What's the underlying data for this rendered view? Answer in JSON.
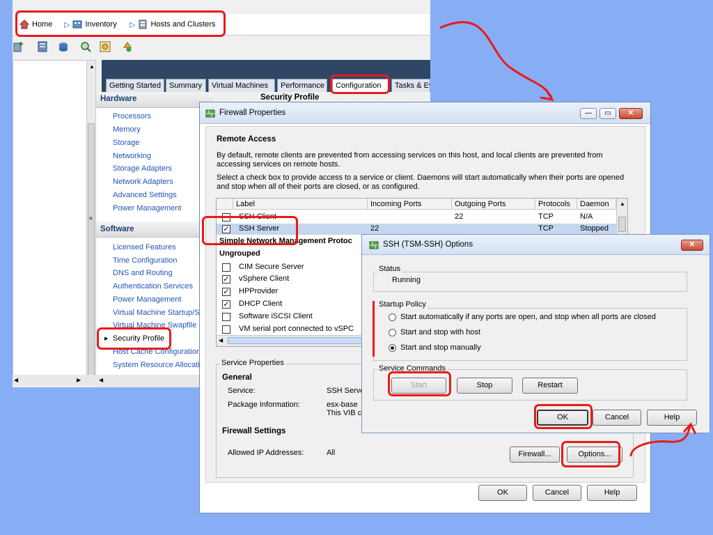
{
  "breadcrumb": {
    "home": "Home",
    "inventory": "Inventory",
    "hosts": "Hosts and Clusters"
  },
  "tabs": [
    "Getting Started",
    "Summary",
    "Virtual Machines",
    "Performance",
    "Configuration",
    "Tasks & Ev"
  ],
  "active_tab": "Configuration",
  "nav": {
    "hardware_title": "Hardware",
    "hardware": [
      "Processors",
      "Memory",
      "Storage",
      "Networking",
      "Storage Adapters",
      "Network Adapters",
      "Advanced Settings",
      "Power Management"
    ],
    "software_title": "Software",
    "software": [
      "Licensed Features",
      "Time Configuration",
      "DNS and Routing",
      "Authentication Services",
      "Power Management",
      "Virtual Machine Startup/Sh",
      "Virtual Machine Swapfile L",
      "Security Profile",
      "Host Cache Configuration",
      "System Resource Allocatio"
    ],
    "selected": "Security Profile"
  },
  "content_title": "Security Profile",
  "firewall": {
    "title": "Firewall Properties",
    "section": "Remote Access",
    "desc1": "By default, remote clients are prevented from accessing services on this host, and local clients are prevented from accessing services on remote hosts.",
    "desc2": "Select a check box to provide access to a service or client. Daemons will start automatically when their ports are opened and stop when all of their ports are closed, or as configured.",
    "columns": [
      "Label",
      "Incoming Ports",
      "Outgoing Ports",
      "Protocols",
      "Daemon"
    ],
    "rows": [
      {
        "label": "SSH Client",
        "in": "",
        "out": "22",
        "proto": "TCP",
        "daemon": "N/A",
        "checked": false
      },
      {
        "label": "SSH Server",
        "in": "22",
        "out": "",
        "proto": "TCP",
        "daemon": "Stopped",
        "checked": true
      }
    ],
    "group_snmp": "Simple Network Management Protoc",
    "group_ungrouped": "Ungrouped",
    "ungrouped": [
      {
        "label": "CIM Secure Server",
        "checked": false
      },
      {
        "label": "vSphere Client",
        "checked": true
      },
      {
        "label": "HPProvider",
        "checked": true
      },
      {
        "label": "DHCP Client",
        "checked": true
      },
      {
        "label": "Software iSCSI Client",
        "checked": false
      },
      {
        "label": "VM serial port connected to vSPC",
        "checked": false
      }
    ],
    "service_properties": "Service Properties",
    "general": "General",
    "service_label": "Service:",
    "service_value": "SSH Server",
    "package_label": "Package Information:",
    "package_value": "esx-base",
    "package_value2": "This VIB co",
    "fw_settings": "Firewall Settings",
    "allowed_label": "Allowed IP Addresses:",
    "allowed_value": "All",
    "firewall_btn": "Firewall...",
    "options_btn": "Options...",
    "ok": "OK",
    "cancel": "Cancel",
    "help": "Help"
  },
  "ssh": {
    "title": "SSH (TSM-SSH) Options",
    "status_legend": "Status",
    "status_value": "Running",
    "policy_legend": "Startup Policy",
    "policy_options": [
      "Start automatically if any ports are open, and stop when all ports are closed",
      "Start and stop with host",
      "Start and stop manually"
    ],
    "policy_selected": 2,
    "commands_legend": "Service Commands",
    "start": "Start",
    "stop": "Stop",
    "restart": "Restart",
    "ok": "OK",
    "cancel": "Cancel",
    "help": "Help"
  },
  "colors": {
    "annotation": "#ea1a1a",
    "link": "#2153b7",
    "header": "#2e4766",
    "background": "#87aef5"
  }
}
